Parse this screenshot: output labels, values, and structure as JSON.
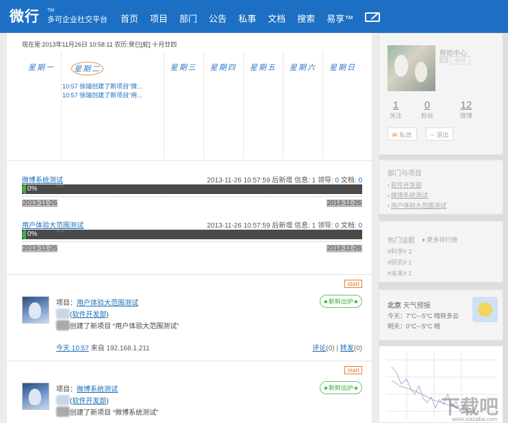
{
  "header": {
    "logo": "微行",
    "tm": "TM",
    "subtitle": "多可企业社交平台",
    "nav": [
      "首页",
      "项目",
      "部门",
      "公告",
      "私事",
      "文档",
      "搜索",
      "易享™"
    ]
  },
  "main": {
    "date_line": "现在是:2013年11月26日 10:58:11 农历:癸巳[蛇] 十月廿四",
    "weekdays": [
      "星期一",
      "星期二",
      "星期三",
      "星期四",
      "星期五",
      "星期六",
      "星期日"
    ],
    "events": [
      "10:57 徐瑞创建了新项目“微...",
      "10:57 徐瑞创建了新项目“用..."
    ],
    "projects": [
      {
        "name": "微博系统测试",
        "meta_prefix": "2013-11-26 10:57:59 后新增 信息:",
        "info": "1",
        "leader_label": "领导:",
        "leader": "0",
        "docs_label": "文档:",
        "docs": "0",
        "progress": "0%",
        "progress_value": 0,
        "bar_year": "2014",
        "start": "2013-11-26",
        "end": "2014-11-26"
      },
      {
        "name": "用户体验大范围测试",
        "meta_prefix": "2013-11-26 10:57:59 后新增 信息:",
        "info": "1",
        "leader_label": "领导:",
        "leader": "0",
        "docs_label": "文档:",
        "docs": "0",
        "progress": "0%",
        "progress_value": 0,
        "bar_year": "2014",
        "start": "2013-11-26",
        "end": "2014-11-26"
      }
    ],
    "posts": [
      {
        "start": "start",
        "fresh": "★新鲜出炉★",
        "project_label": "项目：",
        "project": "用户体验大范围测试",
        "dept": "软件开发部",
        "text": "创建了新项目 “用户体验大范围测试”",
        "time": "今天 10:57",
        "source": "来自 192.168.1.211",
        "comment": "评论",
        "comment_count": "(0)",
        "divider": "|",
        "repost": "转发",
        "repost_count": "(0)"
      },
      {
        "start": "start",
        "fresh": "★新鲜出炉★",
        "project_label": "项目：",
        "project": "微博系统测试",
        "dept": "软件开发部",
        "text": "创建了新项目 “微博系统测试”"
      }
    ]
  },
  "sidebar": {
    "help": "帮助中心",
    "badge_a": "2",
    "badge_b": "604",
    "stats": [
      {
        "value": "1",
        "label": "关注"
      },
      {
        "value": "0",
        "label": "粉丝"
      },
      {
        "value": "12",
        "label": "微博"
      }
    ],
    "btn_message": "私信",
    "btn_logout": "退出",
    "dept_title": "部门与项目",
    "dept_items": [
      "软件开发部",
      "微博系统测试",
      "用户体验大范围测试"
    ],
    "topics_title": "热门话题",
    "topics_more": "更多排行榜",
    "topics": [
      "#科学# 2",
      "#研究# 1",
      "#未来# 1"
    ],
    "weather_city": "北京",
    "weather_title": "天气预报",
    "weather_today": "今天：7°C~-5°C 晴转多云",
    "weather_tomorrow": "明天：0°C~-5°C 晴",
    "watermark": "下载吧",
    "watermark_url": "www.xiazaiba.com"
  },
  "colors": {
    "brand": "#1d6fc4",
    "accent": "#e87b2d",
    "success": "#3fae3f"
  }
}
